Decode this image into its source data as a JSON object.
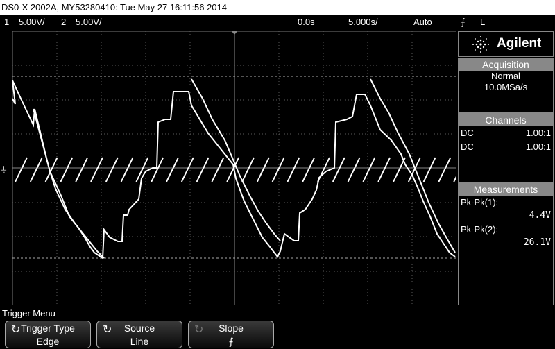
{
  "title": "DS0-X 2002A, MY53280410: Tue May 27 16:11:56 2014",
  "status": {
    "ch1_label": "1",
    "ch1_scale": "5.00V/",
    "ch2_label": "2",
    "ch2_scale": "5.00V/",
    "time_offset": "0.0s",
    "time_scale": "5.000s/",
    "trigger_mode": "Auto",
    "trigger_slope_symbol": "⨍",
    "trigger_source": "L"
  },
  "panel": {
    "brand": "Agilent",
    "acquisition": {
      "heading": "Acquisition",
      "mode": "Normal",
      "rate": "10.0MSa/s"
    },
    "channels": {
      "heading": "Channels",
      "rows": [
        {
          "coupling": "DC",
          "probe": "1.00:1"
        },
        {
          "coupling": "DC",
          "probe": "1.00:1"
        }
      ]
    },
    "measurements": {
      "heading": "Measurements",
      "items": [
        {
          "label": "Pk-Pk(1):",
          "value": "4.4V"
        },
        {
          "label": "Pk-Pk(2):",
          "value": "26.1V"
        }
      ]
    }
  },
  "menu": {
    "title": "Trigger Menu",
    "softkeys": [
      {
        "label": "Trigger Type",
        "value": "Edge",
        "icon": "rotate-knob-icon"
      },
      {
        "label": "Source",
        "value": "Line",
        "icon": "rotate-knob-icon"
      },
      {
        "label": "Slope",
        "value": "⨍",
        "icon": "rotate-knob-icon"
      }
    ]
  },
  "colors": {
    "trace": "#ffffff",
    "grid": "#5a5a5a",
    "panel_header": "#888888"
  }
}
